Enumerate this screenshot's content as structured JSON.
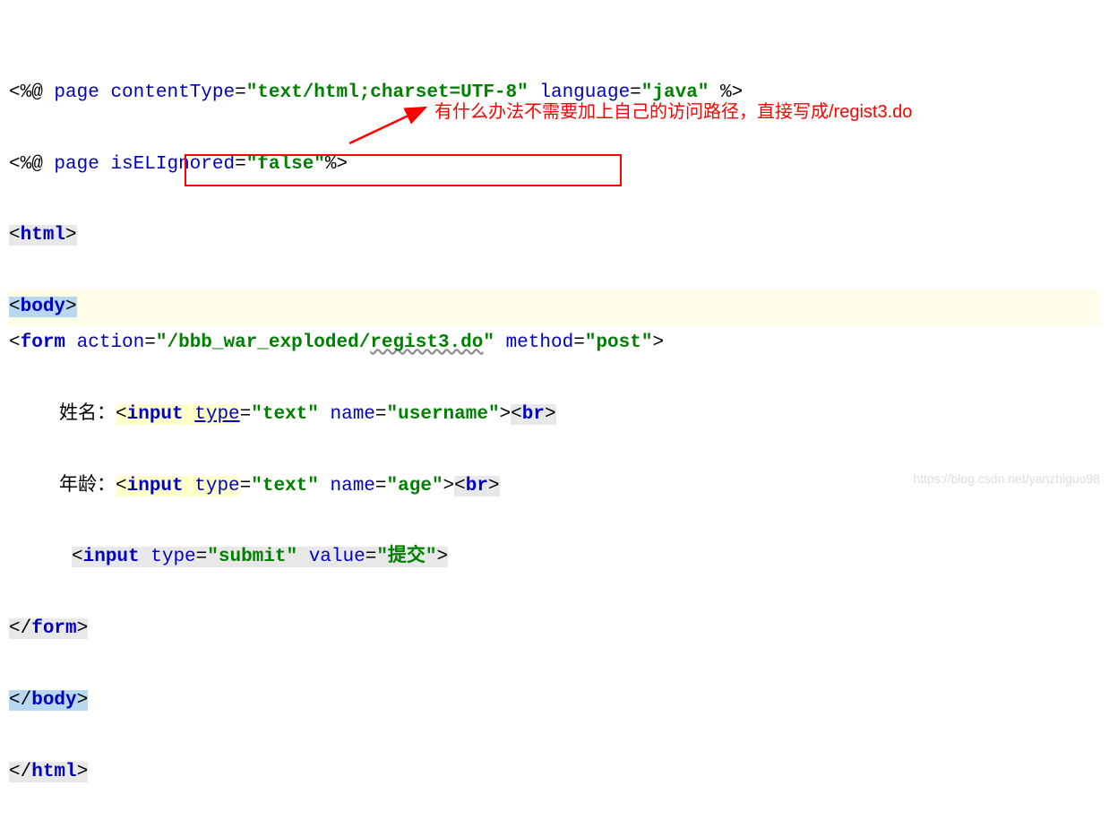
{
  "lines": {
    "l1": {
      "open": "<%@",
      "page": "page",
      "attr1": "contentType",
      "val1": "\"text/html;charset=UTF-8\"",
      "attr2": "language",
      "val2": "\"java\"",
      "close": "%>"
    },
    "l2": {
      "open": "<%@",
      "page": "page",
      "attr1": "isELIgnored",
      "val1": "\"false\"",
      "close": "%>"
    },
    "l3": {
      "open": "<",
      "tag": "html",
      "close": ">"
    },
    "l4": {
      "open": "<",
      "tag": "body",
      "close": ">"
    },
    "l5": {
      "open": "<",
      "tag": "form",
      "attr1": "action",
      "val1_q1": "\"",
      "val1_p1": "/bbb_war_exploded/",
      "val1_p2": "regist3.do",
      "val1_q2": "\"",
      "attr2": "method",
      "val2": "\"post\"",
      "close": ">"
    },
    "l6": {
      "label": "姓名：",
      "open": "<",
      "tag": "input",
      "attr1": "type",
      "val1": "\"text\"",
      "attr2": "name",
      "val2": "\"username\"",
      "close": ">",
      "br_open": "<",
      "br_tag": "br",
      "br_close": ">"
    },
    "l7": {
      "label": "年龄：",
      "open": "<",
      "tag": "input",
      "attr1": "type",
      "val1": "\"text\"",
      "attr2": "name",
      "val2": "\"age\"",
      "close": ">",
      "br_open": "<",
      "br_tag": "br",
      "br_close": ">"
    },
    "l8": {
      "open": "<",
      "tag": "input",
      "attr1": "type",
      "val1": "\"submit\"",
      "attr2": "value",
      "val2": "\"提交\"",
      "close": ">"
    },
    "l9": {
      "open": "</",
      "tag": "form",
      "close": ">"
    },
    "l10": {
      "open": "</",
      "tag": "body",
      "close": ">"
    },
    "l11": {
      "open": "</",
      "tag": "html",
      "close": ">"
    }
  },
  "annotation": "有什么办法不需要加上自己的访问路径，直接写成/regist3.do",
  "watermark": "https://blog.csdn.net/yanzhiguo98"
}
